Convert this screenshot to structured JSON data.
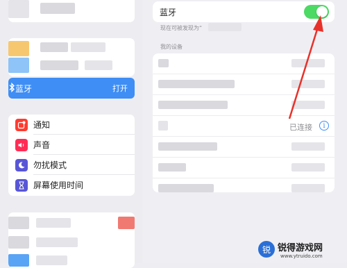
{
  "sidebar": {
    "bluetooth": {
      "label": "蓝牙",
      "value": "打开"
    },
    "items": [
      {
        "label": "通知",
        "icon": "notification-icon",
        "color": "#ff3b30"
      },
      {
        "label": "声音",
        "icon": "speaker-icon",
        "color": "#ff2d55"
      },
      {
        "label": "勿扰模式",
        "icon": "moon-icon",
        "color": "#5856d6"
      },
      {
        "label": "屏幕使用时间",
        "icon": "hourglass-icon",
        "color": "#5856d6"
      }
    ]
  },
  "detail": {
    "bluetooth": {
      "label": "蓝牙",
      "enabled": true
    },
    "discoverable_text": "现在可被发现为“",
    "my_devices_header": "我的设备",
    "connected_status": "已连接"
  },
  "colors": {
    "accent": "#3e8ef5",
    "toggle_on": "#4cd964",
    "arrow": "#e8312a"
  },
  "watermark": {
    "text": "锐得游戏网",
    "url": "www.ytruido.com"
  }
}
